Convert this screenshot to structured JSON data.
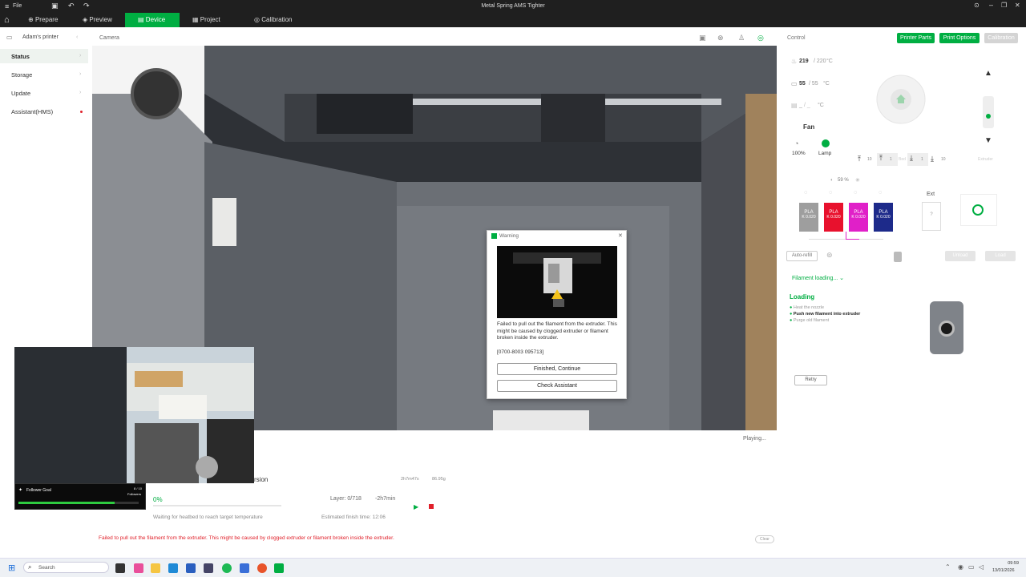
{
  "titlebar": {
    "file": "File",
    "title": "Metal Spring AMS Tighter"
  },
  "menu": {
    "tabs": [
      {
        "label": "Prepare"
      },
      {
        "label": "Preview"
      },
      {
        "label": "Device"
      },
      {
        "label": "Project"
      },
      {
        "label": "Calibration"
      }
    ]
  },
  "sidebar": {
    "printer_name": "Adam's printer",
    "items": [
      {
        "label": "Status"
      },
      {
        "label": "Storage"
      },
      {
        "label": "Update"
      },
      {
        "label": "Assistant(HMS)"
      }
    ]
  },
  "camera": {
    "label": "Camera",
    "status": "Playing..."
  },
  "dialog": {
    "title": "Warning",
    "message": "Failed to pull out the filament from the extruder. This might be caused by clogged extruder or filament broken inside the extruder.",
    "code": "[0700-8003 095713]",
    "btn_continue": "Finished, Continue",
    "btn_assistant": "Check Assistant"
  },
  "job": {
    "name_partial": "rsion",
    "time_small": "2h7m47s",
    "weight_small": "86.95g",
    "progress": "0",
    "progress_unit": "%",
    "layer": "Layer: 0/718",
    "remaining": "-2h7min",
    "waiting": "Waiting for heatbed to reach target temperature",
    "finish": "Estimated finish time: 12:06",
    "error": "Failed to pull out the filament from the extruder. This might be caused by clogged extruder or filament broken inside the extruder.",
    "clear": "Clear"
  },
  "webcam_overlay": {
    "goal_title": "Follower Goal",
    "goal_count": "8 / 10",
    "goal_unit": "Followers",
    "goal_fraction": 0.8
  },
  "control": {
    "label": "Control",
    "btn_parts": "Printer Parts",
    "btn_options": "Print Options",
    "btn_calib": "Calibration",
    "nozzle_temp": "219",
    "nozzle_target": "/ 220",
    "bed_temp": "55",
    "bed_target": "/ 55",
    "chamber_temp": "_",
    "chamber_target": "/ _",
    "unit": "°C",
    "fan_label": "Fan",
    "fan_speed": "100%",
    "lamp_label": "Lamp",
    "move_up_10": "10",
    "move_up_1": "1",
    "move_down_1": "1",
    "move_down_10": "10",
    "bed_label": "Bed",
    "extruder_label": "Extruder",
    "humidity": "59 %",
    "slots": [
      {
        "id": "A1",
        "type": "PLA",
        "k": "K 0.020",
        "color": "#9e9e9e"
      },
      {
        "id": "A2",
        "type": "PLA",
        "k": "K 0.020",
        "color": "#e8112d"
      },
      {
        "id": "A3",
        "type": "PLA",
        "k": "K 0.020",
        "color": "#e020c8"
      },
      {
        "id": "A4",
        "type": "PLA",
        "k": "K 0.020",
        "color": "#1d2a8a"
      }
    ],
    "ext_label": "Ext",
    "ext_slot": "?",
    "auto_refill": "Auto-refill",
    "unload": "Unload",
    "load": "Load",
    "filament_loading": "Filament loading...",
    "loading_title": "Loading",
    "steps": [
      "Heat the nozzle",
      "Push new filament into extruder",
      "Purge old filament"
    ],
    "retry": "Retry"
  },
  "taskbar": {
    "search": "Search",
    "time": "09:59",
    "date": "13/01/2026"
  },
  "colors": {
    "accent": "#00ae42",
    "error": "#e0202a"
  }
}
